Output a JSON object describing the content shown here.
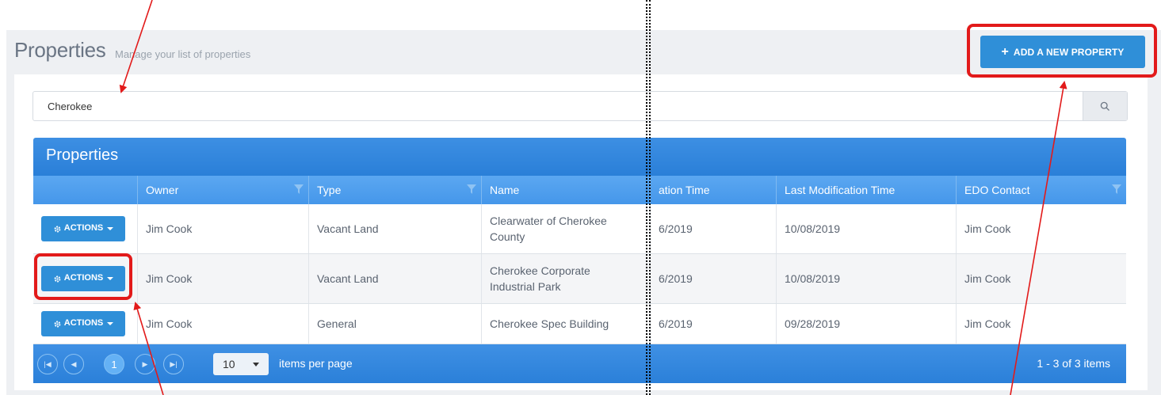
{
  "page": {
    "title": "Properties",
    "subtitle": "Manage your list of properties",
    "add_button": "ADD A NEW PROPERTY"
  },
  "search": {
    "value": "Cherokee",
    "icon": "search-icon"
  },
  "grid": {
    "title": "Properties",
    "columns": [
      "Owner",
      "Type",
      "Name",
      "ation Time",
      "Last Modification Time",
      "EDO Contact"
    ],
    "action_label": "ACTIONS",
    "rows": [
      {
        "owner": "Jim Cook",
        "type": "Vacant Land",
        "name_line1": "Clearwater of Cherokee",
        "name_line2": "County",
        "creation": "6/2019",
        "modified": "10/08/2019",
        "contact": "Jim Cook"
      },
      {
        "owner": "Jim Cook",
        "type": "Vacant Land",
        "name_line1": "Cherokee Corporate",
        "name_line2": "Industrial Park",
        "creation": "6/2019",
        "modified": "10/08/2019",
        "contact": "Jim Cook"
      },
      {
        "owner": "Jim Cook",
        "type": "General",
        "name_line1": "Cherokee Spec Building",
        "name_line2": "",
        "creation": "6/2019",
        "modified": "09/28/2019",
        "contact": "Jim Cook"
      }
    ]
  },
  "pager": {
    "current_page": "1",
    "per_page": "10",
    "per_page_label": "items per page",
    "items_info": "1 - 3 of 3 items"
  },
  "colors": {
    "accent": "#2f8fd8",
    "header": "#2a7fd8",
    "annotation": "#e21a1a"
  }
}
